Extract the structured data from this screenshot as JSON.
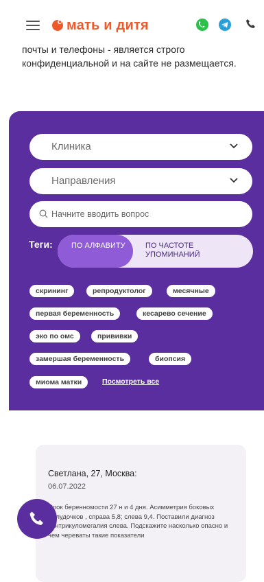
{
  "header": {
    "logo_text": "мать и дитя",
    "brand_color": "#ef5a2b",
    "icons": [
      "burger-menu-icon",
      "whatsapp-icon",
      "telegram-icon",
      "phone-icon"
    ]
  },
  "intro_text": "почты и телефоны - является строго конфиденциальной и на сайте не размещается.",
  "filters": {
    "clinic_label": "Клиника",
    "direction_label": "Направления",
    "search_placeholder": "Начните вводить вопрос",
    "search_value": ""
  },
  "tags": {
    "label": "Теги:",
    "sort_alpha": "ПО АЛФАВИТУ",
    "sort_freq": "ПО ЧАСТОТЕ УПОМИНАНИЙ",
    "items": [
      "скрининг",
      "репродуктолог",
      "месячные",
      "первая беременность",
      "кесарево сечение",
      "эко по омс",
      "прививки",
      "замершая беременность",
      "биопсия",
      "миома матки"
    ],
    "see_all": "Посмотреть все"
  },
  "question": {
    "author": "Светлана, 27, Москва:",
    "date": "06.07.2022",
    "text": "Срок беренномости 27 н и 4 дня. Асимметрия боковых желудочков , справа 5,8; слева 9,4. Поставили диагноз вентрикуломегалия слева. Подскажите насколько опасно и чем череваты такие показатели"
  },
  "colors": {
    "panel": "#5b2ea0",
    "toggle_active": "#8f5bd6"
  }
}
